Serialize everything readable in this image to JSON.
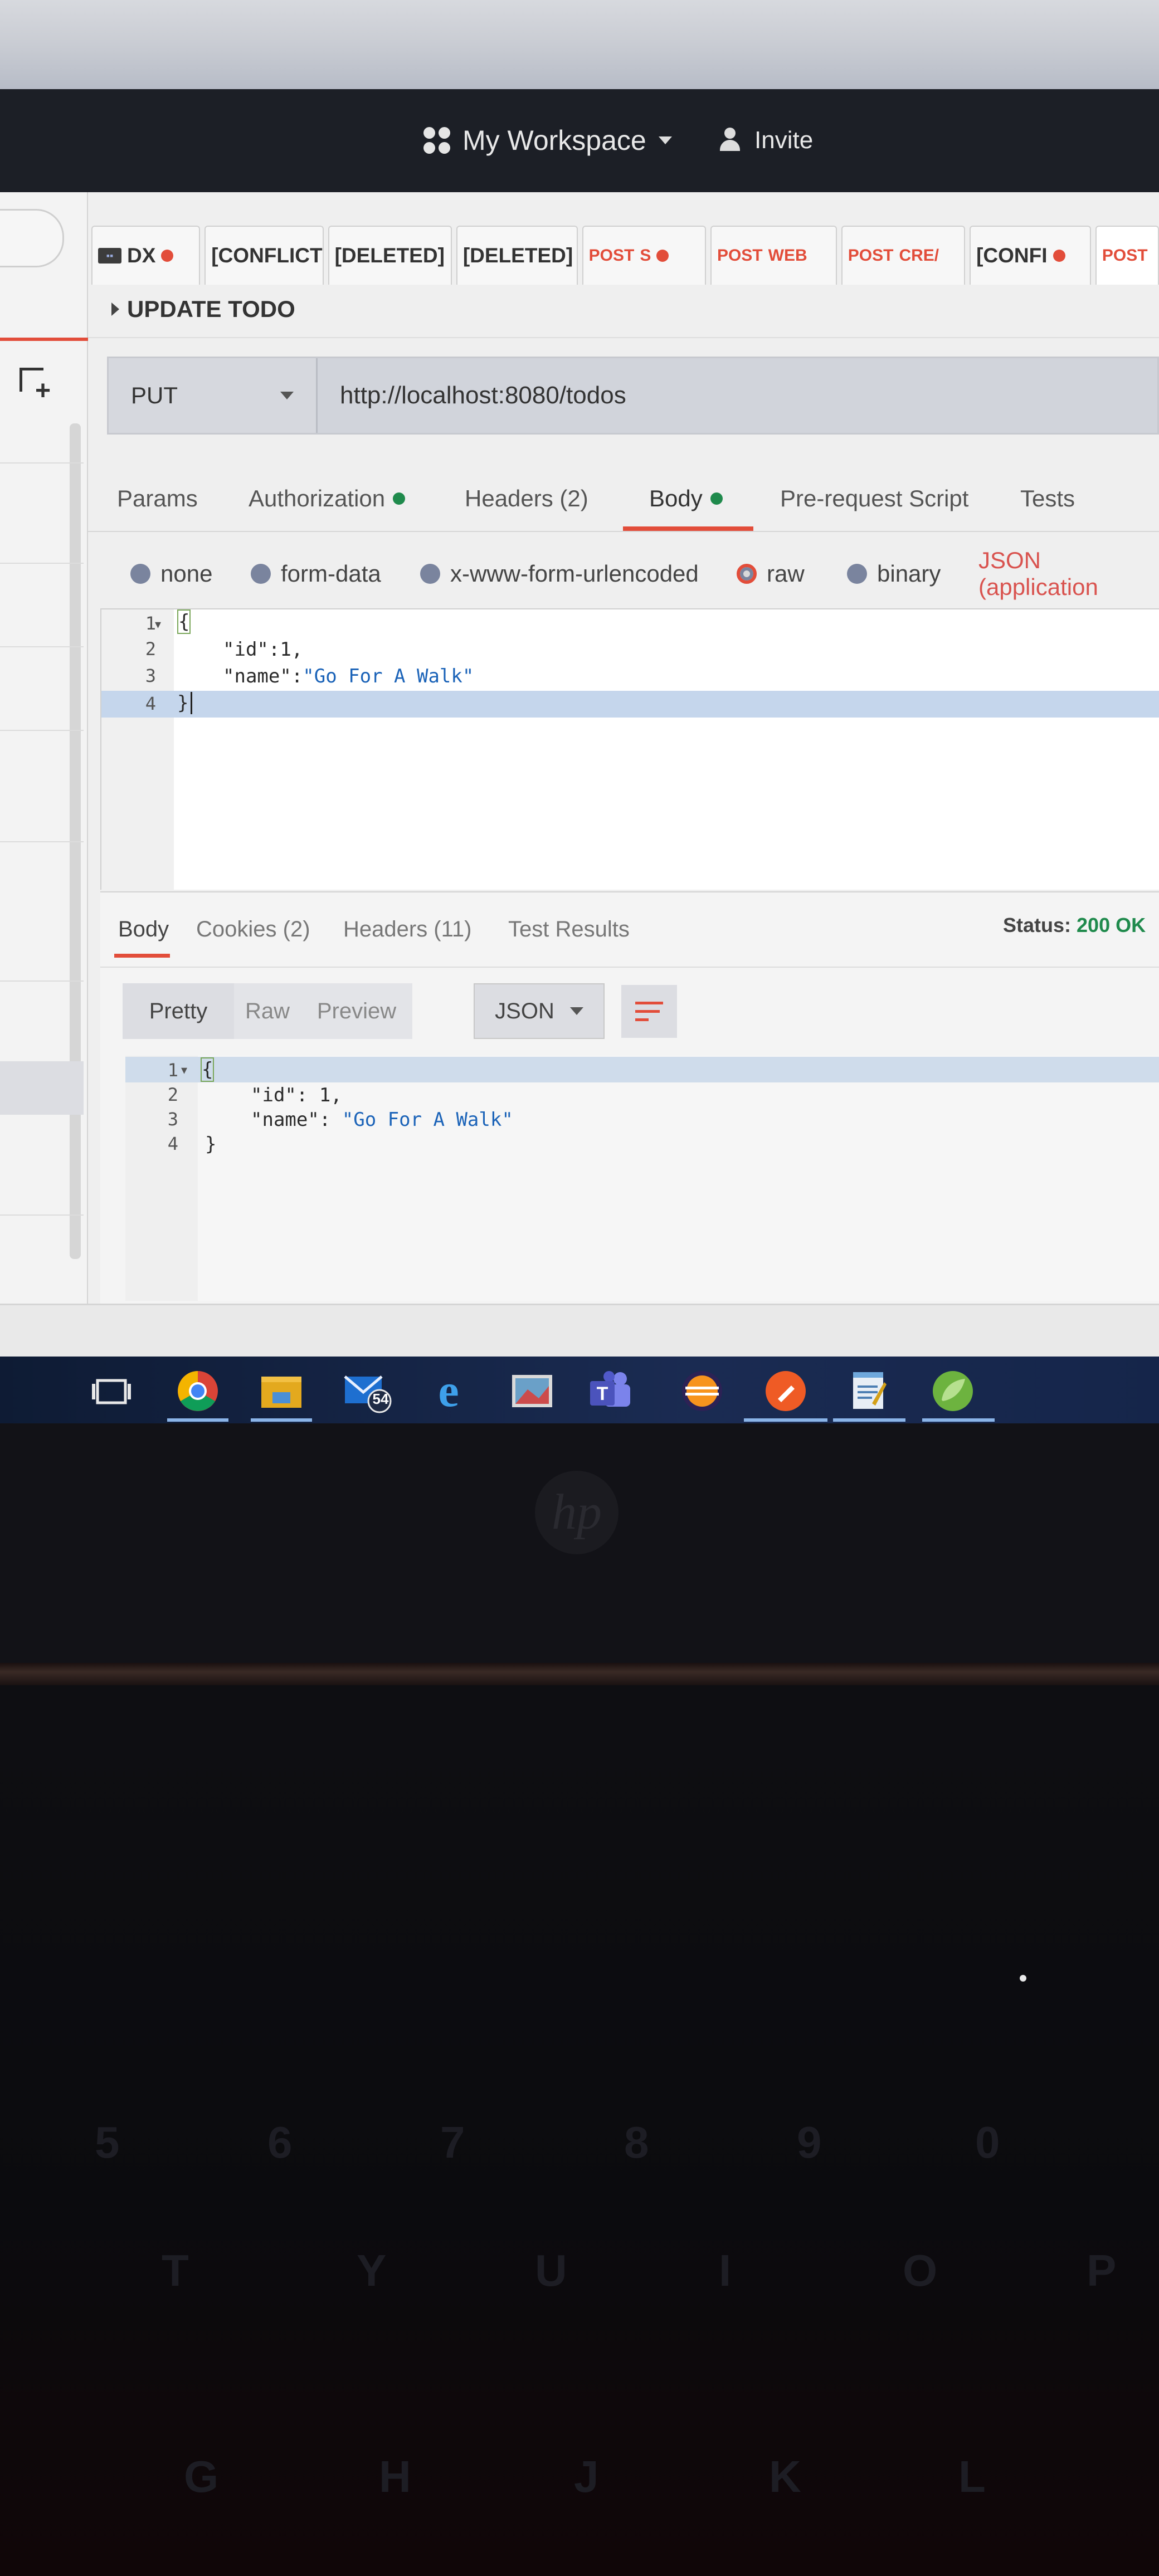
{
  "header": {
    "workspace_label": "My Workspace",
    "invite_label": "Invite"
  },
  "tabs": [
    {
      "label": "DX",
      "dot": true
    },
    {
      "label": "[CONFLICT"
    },
    {
      "label": "[DELETED]"
    },
    {
      "label": "[DELETED]"
    },
    {
      "method": "POST",
      "label": "S",
      "dot": true
    },
    {
      "method": "POST",
      "label": "WEB"
    },
    {
      "method": "POST",
      "label": "CRE/"
    },
    {
      "label": "[CONFI",
      "dot": true
    },
    {
      "method": "POST",
      "label": ""
    }
  ],
  "request": {
    "name": "UPDATE TODO",
    "method": "PUT",
    "url": "http://localhost:8080/todos",
    "subtabs": {
      "params": "Params",
      "authorization": "Authorization",
      "headers": "Headers (2)",
      "body": "Body",
      "prerequest": "Pre-request Script",
      "tests": "Tests"
    },
    "body_types": {
      "none": "none",
      "form_data": "form-data",
      "urlencoded": "x-www-form-urlencoded",
      "raw": "raw",
      "binary": "binary",
      "content_type": "JSON (application"
    },
    "code": {
      "l1": "{",
      "l2a": "\"id\":1,",
      "l3a": "\"name\":",
      "l3b": "\"Go For A Walk\"",
      "l4": "}"
    },
    "line_numbers": [
      "1",
      "2",
      "3",
      "4"
    ]
  },
  "response": {
    "tabs": {
      "body": "Body",
      "cookies": "Cookies (2)",
      "headers": "Headers (11)",
      "tests": "Test Results"
    },
    "status_label": "Status:",
    "status_value": "200 OK",
    "view": {
      "pretty": "Pretty",
      "raw": "Raw",
      "preview": "Preview",
      "format": "JSON"
    },
    "code": {
      "l1": "{",
      "l2a": "\"id\": 1,",
      "l3a": "\"name\": ",
      "l3b": "\"Go For A Walk\"",
      "l4": "}"
    },
    "line_numbers": [
      "1",
      "2",
      "3",
      "4"
    ]
  },
  "taskbar": {
    "mail_badge": "54"
  },
  "hardware": {
    "logo": "hp",
    "keys": [
      "5",
      "6",
      "7",
      "8",
      "9",
      "0",
      "T",
      "Y",
      "U",
      "I",
      "O",
      "P",
      "G",
      "H",
      "J",
      "K",
      "L"
    ]
  },
  "colors": {
    "accent": "#e24d3a",
    "status_ok": "#1f8a4c",
    "header_bg": "#1c1f26"
  }
}
